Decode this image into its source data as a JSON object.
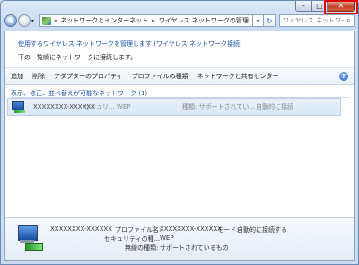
{
  "window": {
    "minimize_glyph": "–",
    "maximize_glyph": "□",
    "close_glyph": "✕"
  },
  "nav": {
    "back_glyph": "◀",
    "forward_glyph": "▶",
    "dropdown_glyph": "▾",
    "breadcrumb_prefix": "«",
    "breadcrumb": [
      "ネットワークとインターネット",
      "ワイヤレス ネットワークの管理"
    ],
    "breadcrumb_sep": "▸",
    "refresh_glyph": "↻",
    "search_placeholder": "ワイヤレス ネットワー...",
    "search_glyph": "⌕"
  },
  "header": {
    "manage_text": "使用するワイヤレス ネットワークを管理します (ワイヤレス ネットワーク接続)",
    "hint_text": "下の一覧順にネットワークに接続します。"
  },
  "toolbar": {
    "items": [
      "追加",
      "削除",
      "アダプターのプロパティ",
      "プロファイルの種類",
      "ネットワークと共有センター"
    ],
    "help_glyph": "?"
  },
  "group": {
    "label": "表示、修正、並べ替えが可能なネットワーク (1)"
  },
  "networks": [
    {
      "name": "XXXXXXXX-XXXXXX",
      "security": "セキュリ... WEP",
      "type": "種類: サポートされてい...",
      "mode": "自動的に接続"
    }
  ],
  "details": {
    "name": "XXXXXXXX-XXXXXX",
    "profile_label": "プロファイル名:",
    "profile_value": "XXXXXXXX-XXXXXX",
    "mode_label": "モード:",
    "mode_value": "自動的に接続する",
    "security_label": "セキュリティの種...",
    "security_value": "WEP",
    "radio_label": "無線の種類:",
    "radio_value": "サポートされているもの"
  },
  "colors": {
    "link": "#1a4fa8",
    "close_highlight": "#e00000",
    "selected_row": "#d9e8f8"
  }
}
